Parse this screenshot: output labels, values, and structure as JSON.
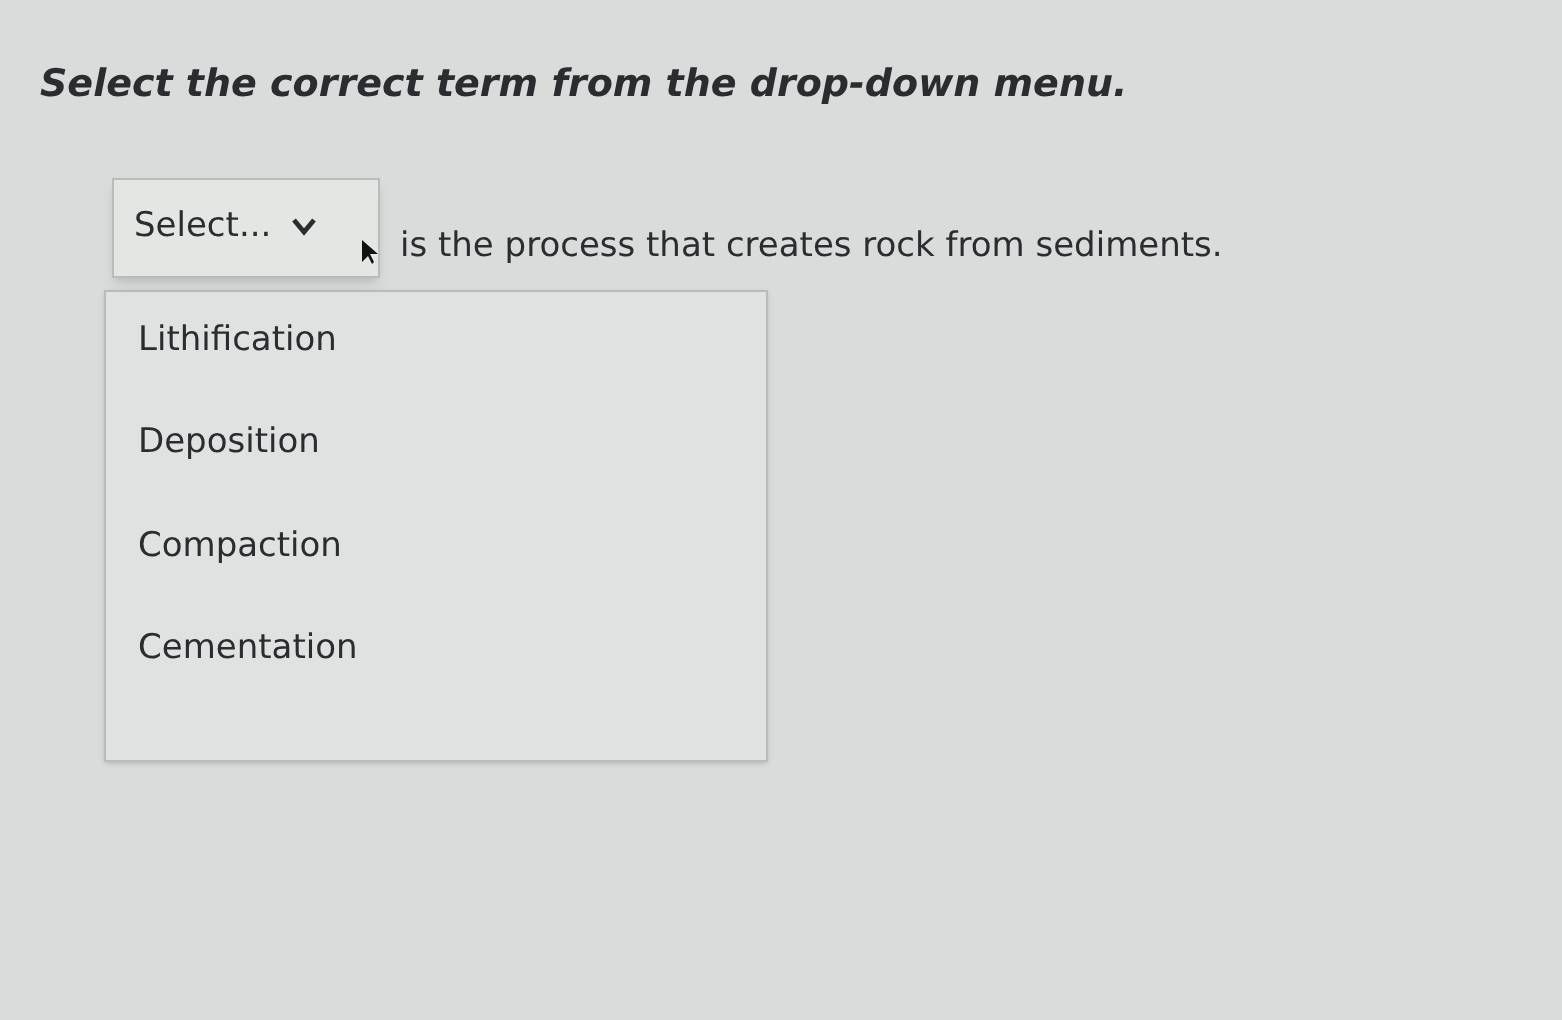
{
  "question": "Select the correct term from the drop-down menu.",
  "dropdown": {
    "value": "Select...",
    "expanded": true,
    "options": [
      "Lithification",
      "Deposition",
      "Compaction",
      "Cementation"
    ]
  },
  "sentence": "is the process that creates rock from sediments."
}
